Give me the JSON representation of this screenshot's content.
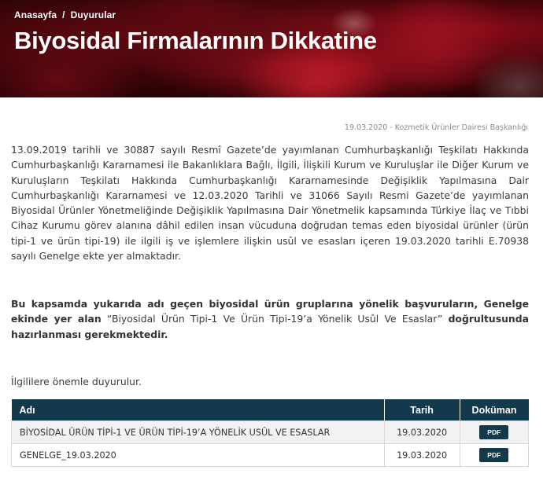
{
  "breadcrumb": {
    "home": "Anasayfa",
    "separator": "/",
    "current": "Duyurular"
  },
  "page": {
    "title": "Biyosidal Firmalarının Dikkatine"
  },
  "meta": {
    "date": "19.03.2020",
    "dash": " - ",
    "department": "Kozmetik Ürünler Dairesi Başkanlığı"
  },
  "content": {
    "paragraph1": "13.09.2019 tarihli ve 30887 sayılı Resmî Gazete’de yayımlanan Cumhurbaşkanlığı Teşkilatı Hakkında Cumhurbaşkanlığı Kararnamesi ile Bakanlıklara Bağlı, İlgili, İlişkili Kurum ve Kuruluşlar ile Diğer Kurum ve Kuruluşların Teşkilatı Hakkında Cumhurbaşkanlığı Kararnamesinde Değişiklik Yapılmasına Dair Cumhurbaşkanlığı Kararnamesi ve 12.03.2020 Tarihli ve 31066 Sayılı Resmi Gazete’de yayımlanan Biyosidal Ürünler Yönetmeliğinde Değişiklik Yapılmasına Dair Yönetmelik kapsamında Türkiye İlaç ve Tıbbi Cihaz Kurumu görev alanına dâhil edilen insan vücuduna doğrudan temas eden biyosidal ürünler (ürün tipi-1 ve ürün tipi-19) ile ilgili iş ve işlemlere ilişkin usûl ve esasları içeren 19.03.2020 tarihli E.70938 sayılı Genelge ekte yer almaktadır.",
    "paragraph2_bold_a": "Bu kapsamda yukarıda adı geçen biyosidal ürün gruplarına yönelik başvuruların, Genelge ekinde yer alan",
    "paragraph2_normal": " “Biyosidal Ürün Tipi-1 Ve Ürün Tipi-19’a Yönelik Usûl Ve Esaslar” ",
    "paragraph2_bold_b": "doğrultusunda hazırlanması gerekmektedir.",
    "paragraph3": "İlgililere önemle duyurulur."
  },
  "table": {
    "headers": {
      "name": "Adı",
      "date": "Tarih",
      "doc": "Doküman"
    },
    "rows": [
      {
        "name": "BİYOSİDAL ÜRÜN TİPİ-1 VE ÜRÜN TİPİ-19’A YÖNELİK USÛL VE ESASLAR",
        "date": "19.03.2020",
        "doc": "PDF"
      },
      {
        "name": "GENELGE_19.03.2020",
        "date": "19.03.2020",
        "doc": "PDF"
      }
    ]
  }
}
